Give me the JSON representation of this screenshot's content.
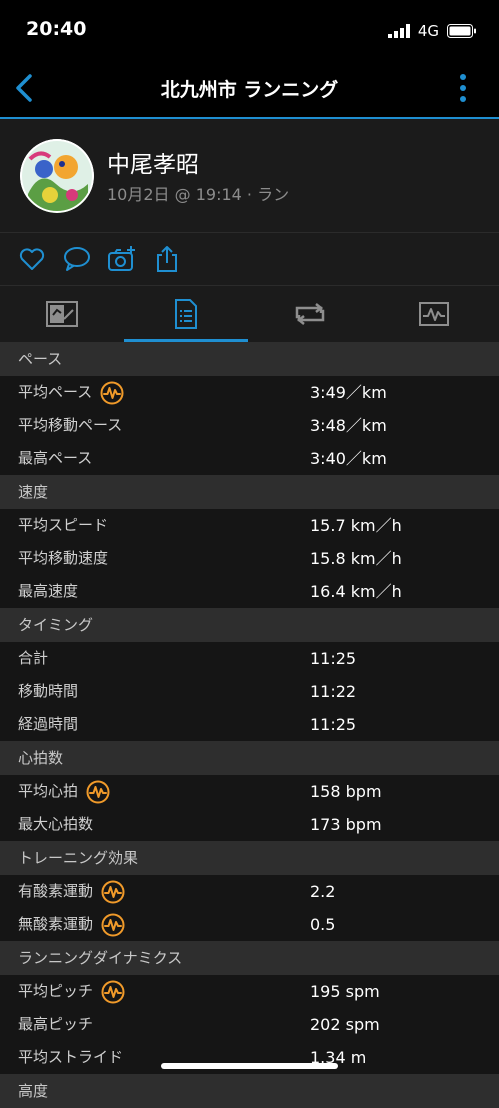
{
  "status_bar": {
    "time": "20:40",
    "network": "4G"
  },
  "nav": {
    "title": "北九州市 ランニング"
  },
  "activity": {
    "user_name": "中尾孝昭",
    "meta": "10月2日 @ 19:14 · ラン"
  },
  "colors": {
    "accent": "#1f8fd1",
    "badge": "#f09a2a"
  },
  "icons": {
    "back": "chevron-left-icon",
    "more": "vertical-dots-icon",
    "like": "heart-icon",
    "comment": "speech-bubble-icon",
    "photo": "camera-plus-icon",
    "share": "share-icon",
    "tabs": [
      "map-overview-icon",
      "stats-list-icon",
      "laps-icon",
      "graph-icon"
    ],
    "badge": "heart-rate-wave-icon"
  },
  "tabs": {
    "active_index": 1
  },
  "sections": [
    {
      "title": "ペース",
      "rows": [
        {
          "label": "平均ペース",
          "value": "3:49／km",
          "badge": true
        },
        {
          "label": "平均移動ペース",
          "value": "3:48／km",
          "badge": false
        },
        {
          "label": "最高ペース",
          "value": "3:40／km",
          "badge": false
        }
      ]
    },
    {
      "title": "速度",
      "rows": [
        {
          "label": "平均スピード",
          "value": "15.7 km／h",
          "badge": false
        },
        {
          "label": "平均移動速度",
          "value": "15.8 km／h",
          "badge": false
        },
        {
          "label": "最高速度",
          "value": "16.4 km／h",
          "badge": false
        }
      ]
    },
    {
      "title": "タイミング",
      "rows": [
        {
          "label": "合計",
          "value": "11:25",
          "badge": false
        },
        {
          "label": "移動時間",
          "value": "11:22",
          "badge": false
        },
        {
          "label": "経過時間",
          "value": "11:25",
          "badge": false
        }
      ]
    },
    {
      "title": "心拍数",
      "rows": [
        {
          "label": "平均心拍",
          "value": "158 bpm",
          "badge": true
        },
        {
          "label": "最大心拍数",
          "value": "173 bpm",
          "badge": false
        }
      ]
    },
    {
      "title": "トレーニング効果",
      "rows": [
        {
          "label": "有酸素運動",
          "value": "2.2",
          "badge": true
        },
        {
          "label": "無酸素運動",
          "value": "0.5",
          "badge": true
        }
      ]
    },
    {
      "title": "ランニングダイナミクス",
      "rows": [
        {
          "label": "平均ピッチ",
          "value": "195 spm",
          "badge": true
        },
        {
          "label": "最高ピッチ",
          "value": "202 spm",
          "badge": false
        },
        {
          "label": "平均ストライド",
          "value": "1.34 m",
          "badge": false
        }
      ]
    },
    {
      "title": "高度",
      "rows": []
    }
  ]
}
